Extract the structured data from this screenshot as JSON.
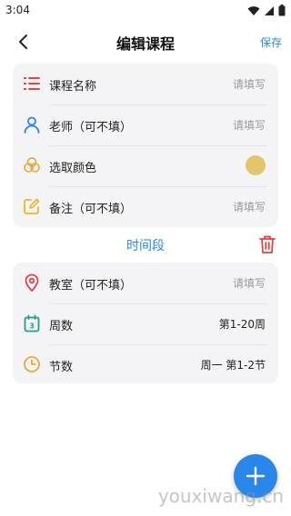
{
  "status_bar": {
    "time": "3:04",
    "icons": [
      "wifi-icon",
      "signal-icon",
      "battery-icon"
    ]
  },
  "header": {
    "back_icon": "chevron-left-icon",
    "title": "编辑课程",
    "save_label": "保存"
  },
  "course_fields": [
    {
      "icon": "list-icon",
      "label": "课程名称",
      "value": "请填写"
    },
    {
      "icon": "person-icon",
      "label": "老师（可不填）",
      "value": "请填写"
    },
    {
      "icon": "palette-icon",
      "label": "选取颜色",
      "color": "#e3c66c"
    },
    {
      "icon": "edit-note-icon",
      "label": "备注（可不填）",
      "value": "请填写"
    }
  ],
  "time_section": {
    "title": "时间段",
    "delete_icon": "trash-icon"
  },
  "time_fields": [
    {
      "icon": "location-pin-icon",
      "label": "教室（可不填）",
      "value": "请填写"
    },
    {
      "icon": "calendar-icon",
      "label": "周数",
      "value": "第1-20周"
    },
    {
      "icon": "clock-icon",
      "label": "节数",
      "value": "周一 第1-2节"
    }
  ],
  "fab": {
    "icon": "plus-icon",
    "color": "#2a86e8"
  },
  "watermark": "youxiwang.cn",
  "colors": {
    "accent": "#2a86e8",
    "danger": "#e24343",
    "placeholder": "#999999"
  }
}
